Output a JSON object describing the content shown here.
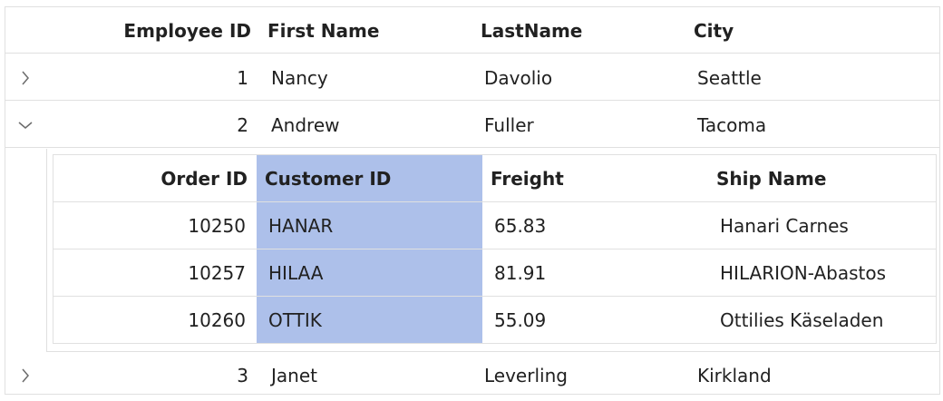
{
  "parent_grid": {
    "columns": [
      "Employee ID",
      "First Name",
      "LastName",
      "City"
    ],
    "rows": [
      {
        "id": "1",
        "first": "Nancy",
        "last": "Davolio",
        "city": "Seattle",
        "expanded": false
      },
      {
        "id": "2",
        "first": "Andrew",
        "last": "Fuller",
        "city": "Tacoma",
        "expanded": true
      },
      {
        "id": "3",
        "first": "Janet",
        "last": "Leverling",
        "city": "Kirkland",
        "expanded": false
      }
    ]
  },
  "child_grid": {
    "columns": [
      "Order ID",
      "Customer ID",
      "Freight",
      "Ship Name"
    ],
    "selected_column": "Customer ID",
    "rows": [
      {
        "order_id": "10250",
        "customer_id": "HANAR",
        "freight": "65.83",
        "ship_name": "Hanari Carnes"
      },
      {
        "order_id": "10257",
        "customer_id": "HILAA",
        "freight": "81.91",
        "ship_name": "HILARION-Abastos"
      },
      {
        "order_id": "10260",
        "customer_id": "OTTIK",
        "freight": "55.09",
        "ship_name": "Ottilies Käseladen"
      }
    ]
  },
  "colors": {
    "selected_column_bg": "#adc0ea",
    "border": "#e0e0e0",
    "text": "#212121",
    "icon": "#6b6b6b"
  },
  "icons": {
    "collapsed": "chevron-right-icon",
    "expanded": "chevron-down-icon"
  }
}
